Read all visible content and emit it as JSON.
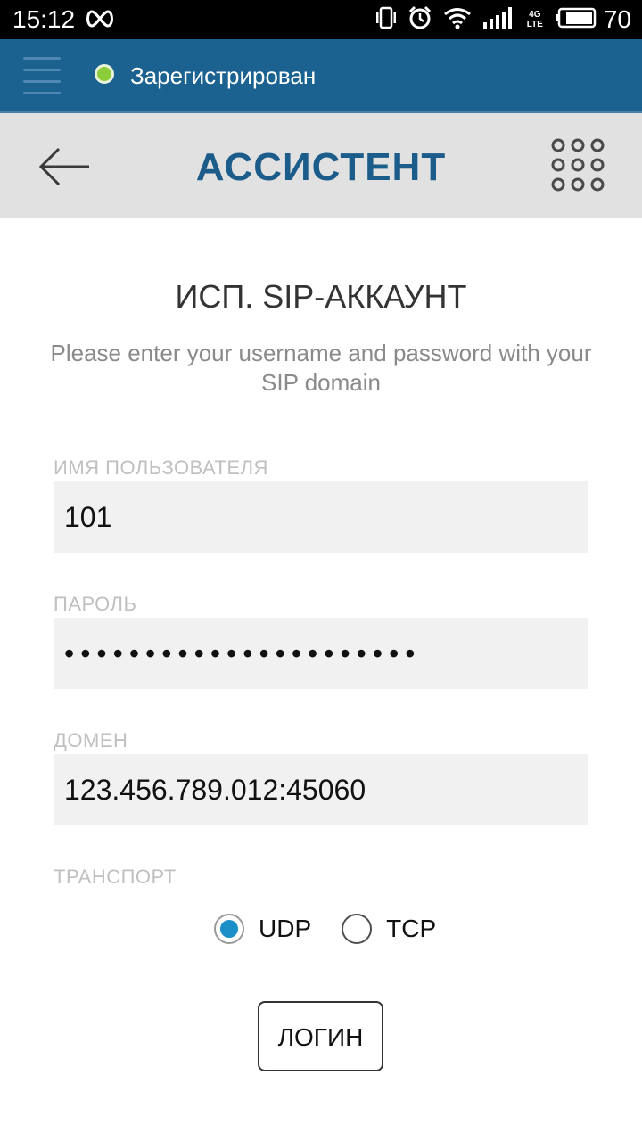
{
  "status_bar": {
    "time": "15:12",
    "battery_percent": "70",
    "network": "4G LTE",
    "icons": [
      "infinity-icon",
      "vibrate-icon",
      "alarm-icon",
      "wifi-icon",
      "signal-icon",
      "battery-icon"
    ]
  },
  "registration": {
    "status_text": "Зарегистрирован",
    "status_color": "#8ccd3a"
  },
  "header": {
    "title": "АССИСТЕНТ"
  },
  "form": {
    "title": "ИСП. SIP-АККАУНТ",
    "instruction": "Please enter your username and password with your SIP domain",
    "username_label": "ИМЯ ПОЛЬЗОВАТЕЛЯ",
    "username_value": "101",
    "password_label": "ПАРОЛЬ",
    "password_value": "••••••••••••••••••••••",
    "domain_label": "ДОМЕН",
    "domain_value": "123.456.789.012:45060",
    "transport_label": "ТРАНСПОРТ",
    "transport_options": [
      "UDP",
      "TCP"
    ],
    "transport_selected": "UDP",
    "login_label": "ЛОГИН"
  },
  "colors": {
    "accent": "#1b6291",
    "title": "#1b5c8a",
    "radio_checked": "#1a8fc8"
  }
}
